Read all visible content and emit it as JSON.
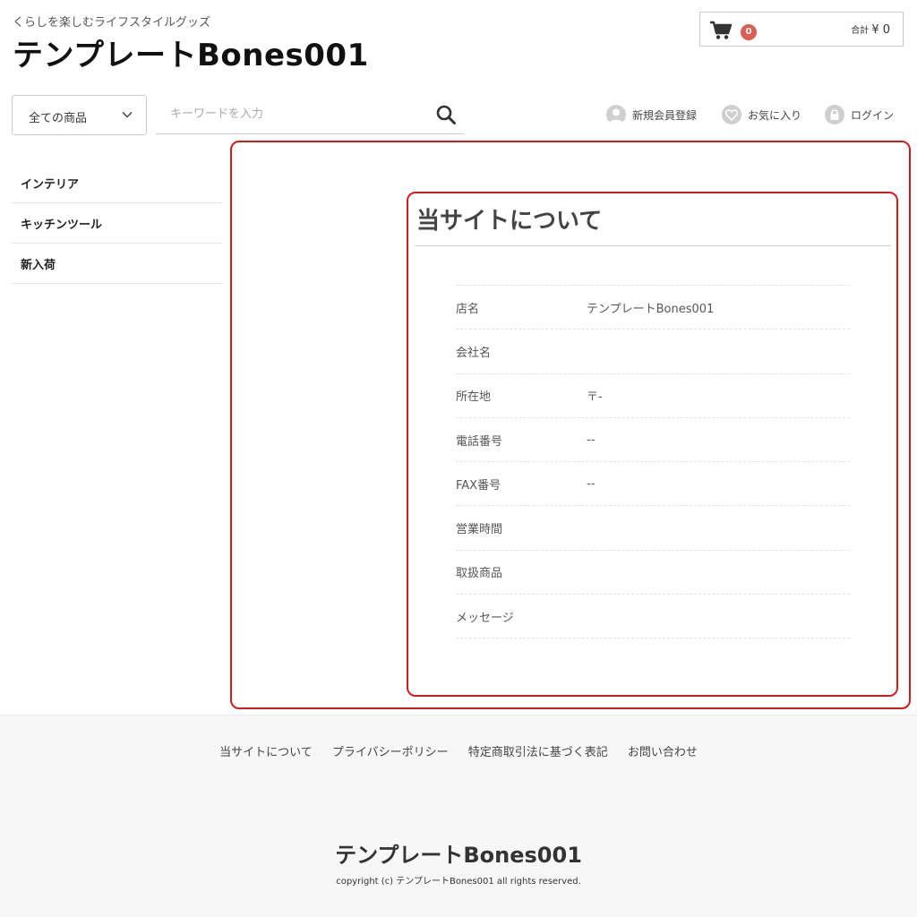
{
  "header": {
    "tagline": "くらしを楽しむライフスタイルグッズ",
    "site_title": "テンプレートBones001"
  },
  "cart": {
    "count": "0",
    "total_label": "合計",
    "total_value": "¥ 0"
  },
  "search": {
    "category": "全ての商品",
    "placeholder": "キーワードを入力"
  },
  "account": {
    "register": "新規会員登録",
    "favorites": "お気に入り",
    "login": "ログイン"
  },
  "sidebar": {
    "items": [
      {
        "label": "インテリア"
      },
      {
        "label": "キッチンツール"
      },
      {
        "label": "新入荷"
      }
    ]
  },
  "main": {
    "title": "当サイトについて",
    "rows": [
      {
        "key": "店名",
        "value": "テンプレートBones001"
      },
      {
        "key": "会社名",
        "value": ""
      },
      {
        "key": "所在地",
        "value": "〒-"
      },
      {
        "key": "電話番号",
        "value": "--"
      },
      {
        "key": "FAX番号",
        "value": "--"
      },
      {
        "key": "営業時間",
        "value": ""
      },
      {
        "key": "取扱商品",
        "value": ""
      },
      {
        "key": "メッセージ",
        "value": ""
      }
    ]
  },
  "footer": {
    "links": [
      {
        "label": "当サイトについて"
      },
      {
        "label": "プライバシーポリシー"
      },
      {
        "label": "特定商取引法に基づく表記"
      },
      {
        "label": "お問い合わせ"
      }
    ],
    "title": "テンプレートBones001",
    "copyright": "copyright (c) テンプレートBones001 all rights reserved."
  },
  "colors": {
    "badge": "#de5d50",
    "annotation": "#d41b1b",
    "footer_bg": "#f7f7f7"
  },
  "icons": [
    "cart-icon",
    "chevron-down-icon",
    "search-icon",
    "user-icon",
    "heart-icon",
    "lock-icon"
  ]
}
